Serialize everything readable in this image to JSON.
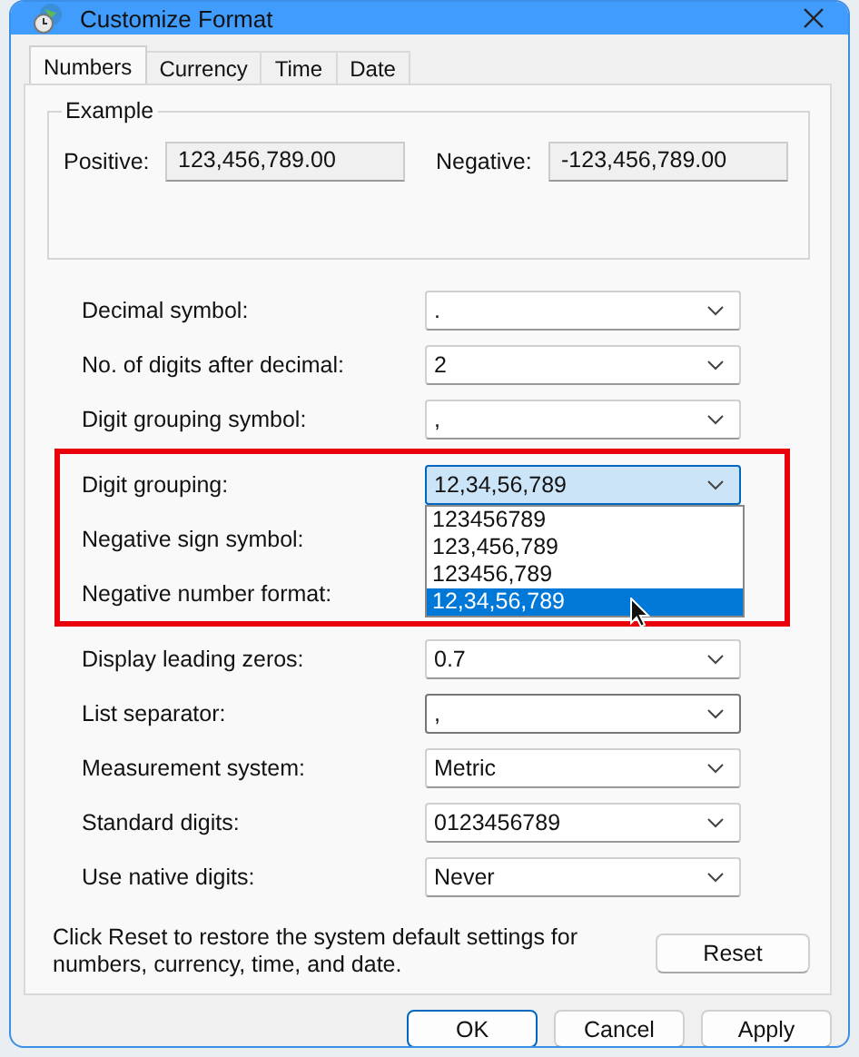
{
  "window": {
    "title": "Customize Format"
  },
  "tabs": [
    {
      "label": "Numbers",
      "selected": true
    },
    {
      "label": "Currency",
      "selected": false
    },
    {
      "label": "Time",
      "selected": false
    },
    {
      "label": "Date",
      "selected": false
    }
  ],
  "example": {
    "title": "Example",
    "positive_label": "Positive:",
    "positive": "123,456,789.00",
    "negative_label": "Negative:",
    "negative": "-123,456,789.00"
  },
  "groups": [
    {
      "highlighted": false,
      "rows": [
        {
          "label": "Decimal symbol:",
          "value": ".",
          "focused": false
        },
        {
          "label": "No. of digits after decimal:",
          "value": "2",
          "focused": false
        },
        {
          "label": "Digit grouping symbol:",
          "value": ",",
          "focused": false
        }
      ]
    },
    {
      "highlighted": true,
      "rows": [
        {
          "label": "Digit grouping:",
          "value": "12,34,56,789",
          "open": true,
          "options": [
            {
              "label": "123456789",
              "selected": false
            },
            {
              "label": "123,456,789",
              "selected": false
            },
            {
              "label": "123456,789",
              "selected": false
            },
            {
              "label": "12,34,56,789",
              "selected": true
            }
          ]
        },
        {
          "label": "Negative sign symbol:"
        },
        {
          "label": "Negative number format:"
        }
      ]
    },
    {
      "highlighted": false,
      "rows": [
        {
          "label": "Display leading zeros:",
          "value": "0.7",
          "focused": false
        },
        {
          "label": "List separator:",
          "value": ",",
          "focused": true
        },
        {
          "label": "Measurement system:",
          "value": "Metric",
          "focused": false
        },
        {
          "label": "Standard digits:",
          "value": "0123456789",
          "focused": false
        },
        {
          "label": "Use native digits:",
          "value": "Never",
          "focused": false
        }
      ]
    }
  ],
  "reset_note": "Click Reset to restore the system default settings for numbers, currency, time, and date.",
  "reset_button": "Reset",
  "buttons": [
    {
      "label": "OK",
      "default": true
    },
    {
      "label": "Cancel",
      "default": false
    },
    {
      "label": "Apply",
      "default": false
    }
  ]
}
